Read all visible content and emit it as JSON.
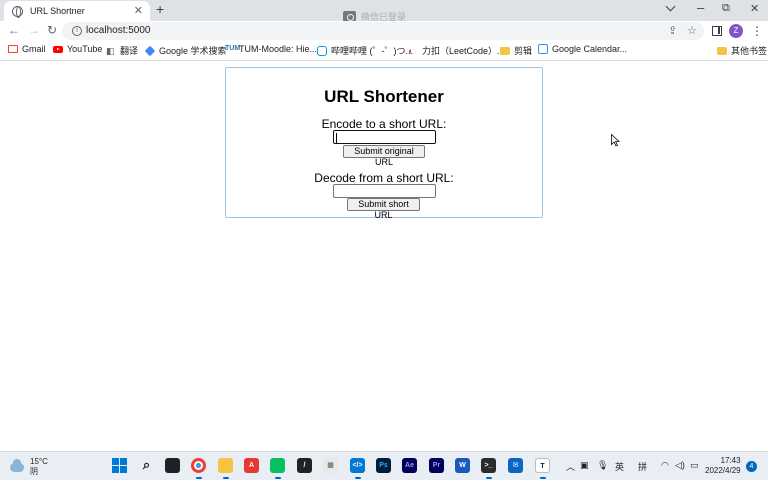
{
  "browser": {
    "tab_title": "URL Shortner",
    "tab_close": "✕",
    "new_tab": "+",
    "window_controls": {
      "restore": "⧉",
      "close": "✕"
    },
    "recording_overlay": "微信已登录",
    "url": "localhost:5000",
    "profile_initial": "Z"
  },
  "bookmarks": [
    {
      "label": "Gmail",
      "icon": "gmail-icon"
    },
    {
      "label": "YouTube",
      "icon": "youtube-icon"
    },
    {
      "label": "翻译",
      "icon": "translate-icon"
    },
    {
      "label": "Google 学术搜索",
      "icon": "google-scholar-icon"
    },
    {
      "label": "TUM-Moodle: Hie...",
      "icon": "tum-icon"
    },
    {
      "label": "哔哩哔哩 (゜-゜)つ...",
      "icon": "bilibili-icon"
    },
    {
      "label": "力扣（LeetCode）...",
      "icon": "leetcode-icon"
    },
    {
      "label": "剪辑",
      "icon": "folder-icon"
    },
    {
      "label": "Google Calendar...",
      "icon": "google-calendar-icon"
    },
    {
      "label": "其他书签",
      "icon": "folder-icon"
    }
  ],
  "page": {
    "title": "URL Shortener",
    "encode_label": "Encode to a short URL:",
    "encode_input_value": "",
    "encode_button": "Submit original URL",
    "decode_label": "Decode from a short URL:",
    "decode_input_value": "",
    "decode_button": "Submit short URL"
  },
  "taskbar": {
    "temperature": "15°C",
    "condition": "阴",
    "ime_lang": "英",
    "ime_mode": "拼",
    "time": "17:43",
    "date": "2022/4/29",
    "notification_count": "4"
  },
  "colors": {
    "card_border": "#9cc3e5",
    "tab_strip": "#dee1e6",
    "taskbar": "#e9eef5",
    "accent": "#0067c0"
  }
}
